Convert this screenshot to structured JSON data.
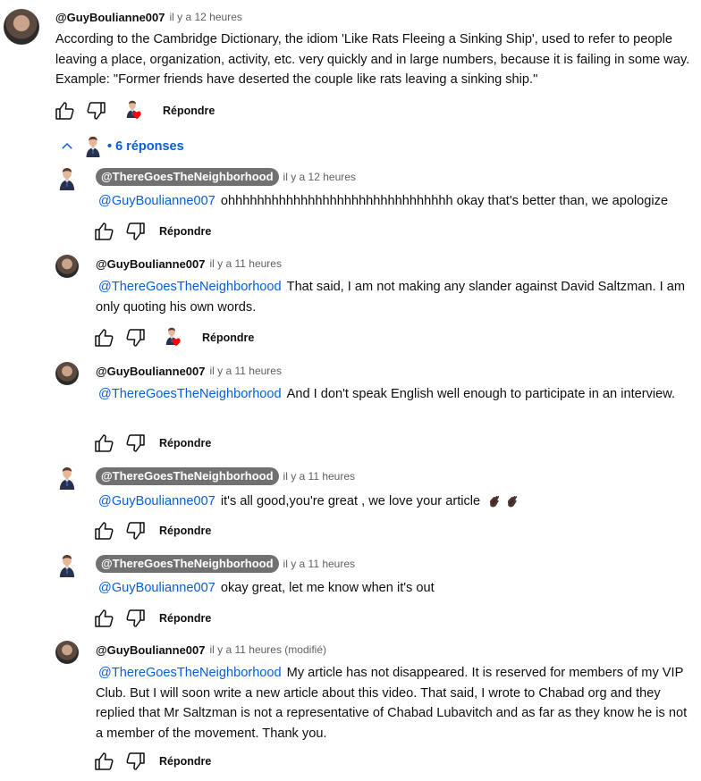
{
  "reply_label": "Répondre",
  "replies_toggle": {
    "dot": "•",
    "label": "6 réponses"
  },
  "top_comment": {
    "author": "@GuyBoulianne007",
    "time": "il y a 12 heures",
    "text": "According to the Cambridge Dictionary, the idiom 'Like Rats Fleeing a Sinking Ship', used to refer to people leaving a place, organization, activity, etc. very quickly and in large numbers, because it is failing in some way. Example: \"Former friends have deserted the couple like rats leaving a sinking ship.\""
  },
  "replies": [
    {
      "author": "@ThereGoesTheNeighborhood",
      "time": "il y a 12 heures",
      "mention": "@GuyBoulianne007",
      "text": "ohhhhhhhhhhhhhhhhhhhhhhhhhhhhhhh okay that's better than, we apologize"
    },
    {
      "author": "@GuyBoulianne007",
      "time": "il y a 11 heures",
      "mention": "@ThereGoesTheNeighborhood",
      "text": "That said, I am not making any slander against David Saltzman. I am only quoting his own words."
    },
    {
      "author": "@GuyBoulianne007",
      "time": "il y a 11 heures",
      "mention": "@ThereGoesTheNeighborhood",
      "text": "And I don't speak English well enough to participate in an interview."
    },
    {
      "author": "@ThereGoesTheNeighborhood",
      "time": "il y a 11 heures",
      "mention": "@GuyBoulianne007",
      "text": "it's all good,you're great , we love your article"
    },
    {
      "author": "@ThereGoesTheNeighborhood",
      "time": "il y a 11 heures",
      "mention": "@GuyBoulianne007",
      "text": "okay great, let me know when it's out"
    },
    {
      "author": "@GuyBoulianne007",
      "time": "il y a 11 heures (modifié)",
      "mention": "@ThereGoesTheNeighborhood",
      "text": "My article has not disappeared. It is reserved for members of my VIP Club. But I will soon write a new article about this video. That said,  I wrote to Chabad org and they replied that Mr Saltzman is not a representative of Chabad Lubavitch and as far as they know he is not a member of the movement. Thank you."
    }
  ],
  "icons": {
    "like": "thumb-up-icon",
    "dislike": "thumb-down-icon",
    "creator_heart": "creator-heart-icon",
    "collapse": "chevron-up-icon",
    "clap": "clapping-hands-emoji"
  },
  "colors": {
    "link": "#065fd4",
    "pill": "#717171",
    "heart": "#ff0000",
    "secondary_text": "#606060"
  }
}
